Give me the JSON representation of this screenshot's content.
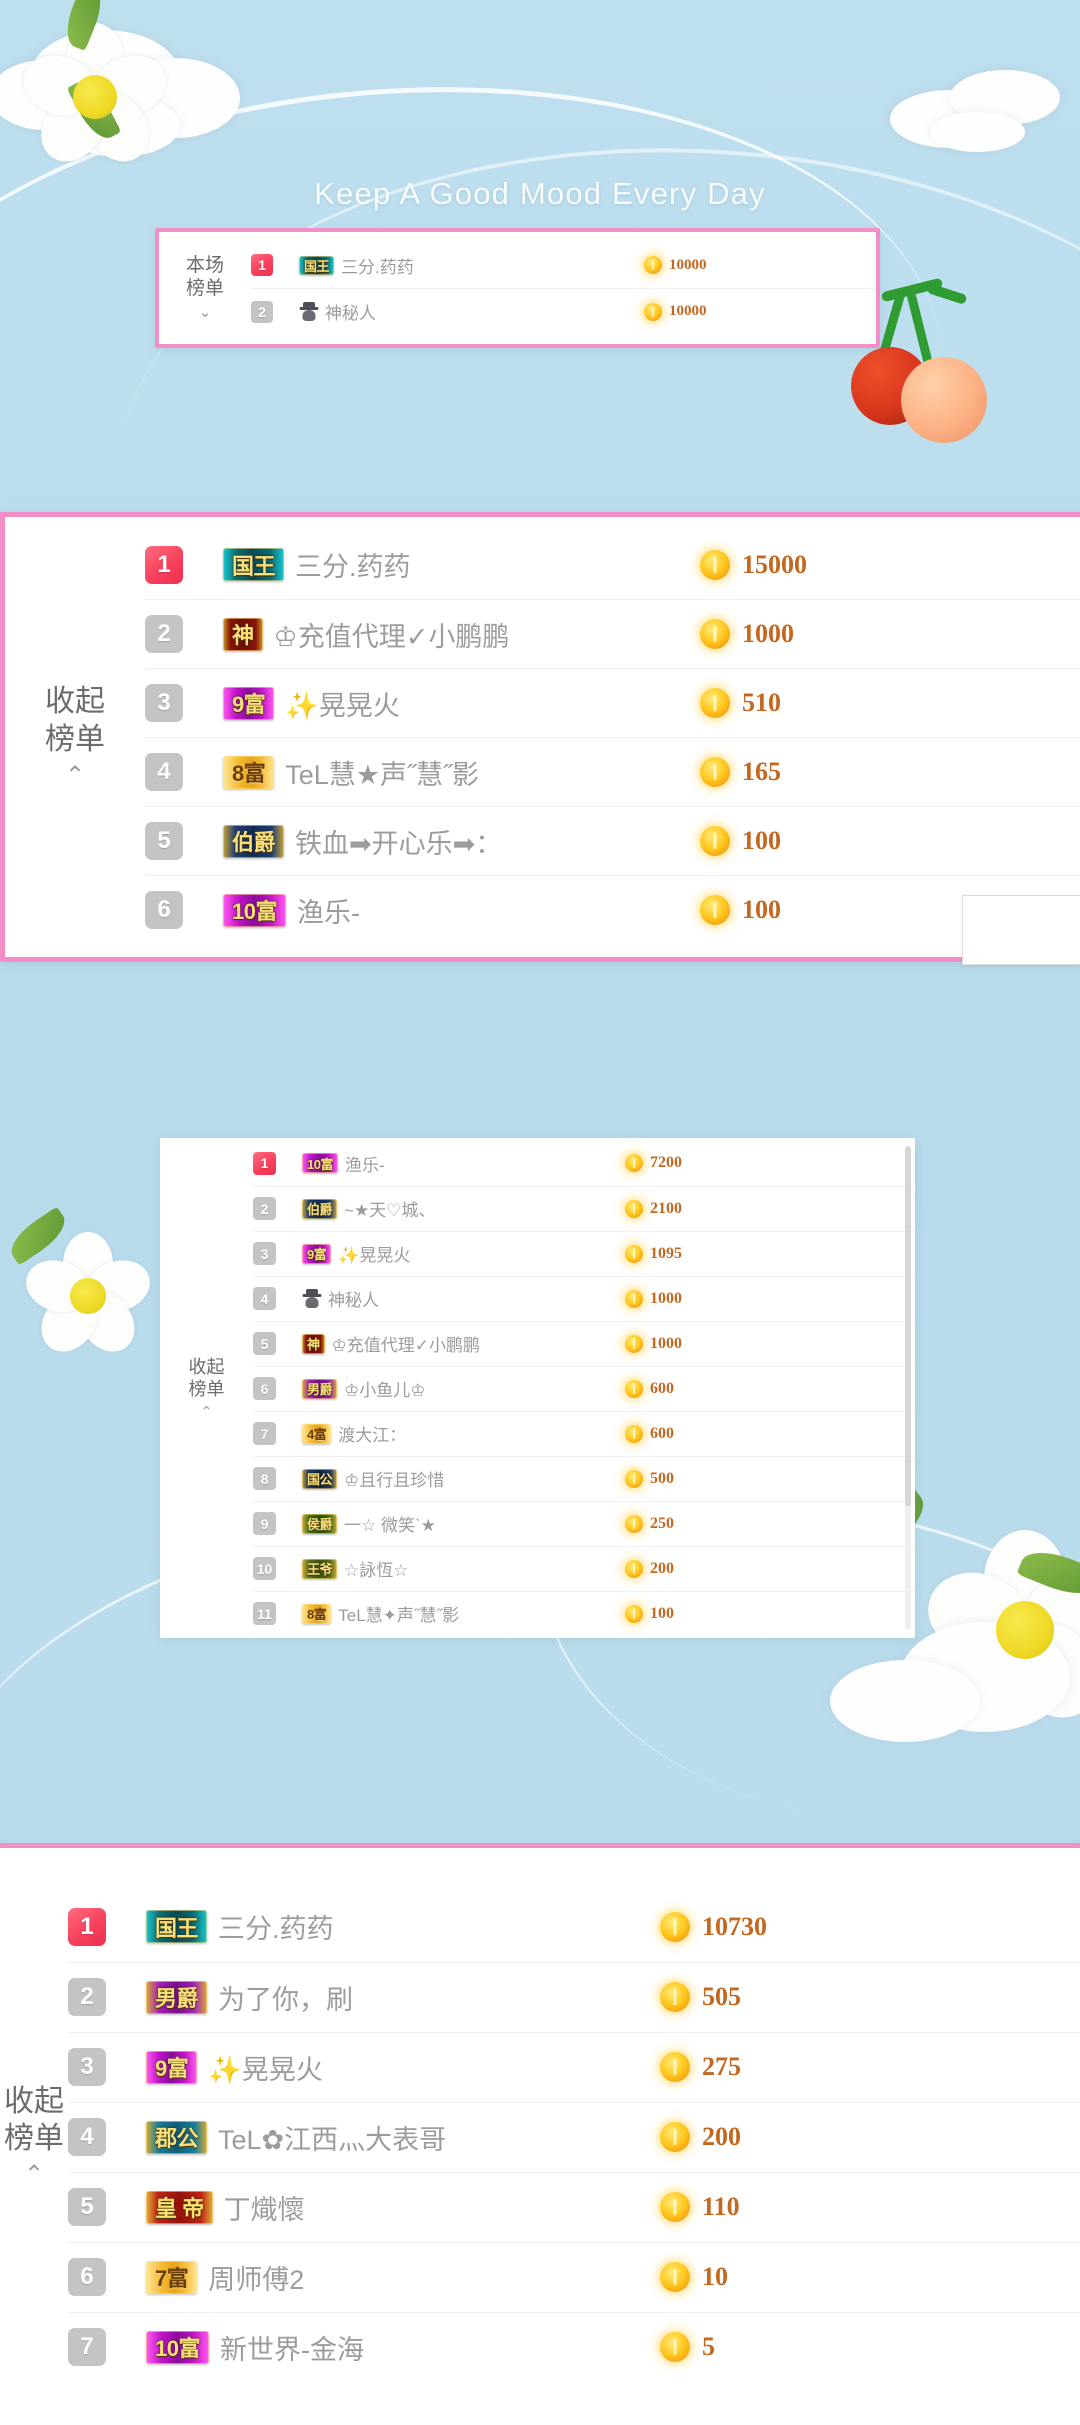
{
  "banner": {
    "title": "Keep A Good Mood Every Day"
  },
  "theme": {
    "background": "#b9dced",
    "panel_border_pink": "#f48ec6",
    "rank1_badge": "#f8415c",
    "rank_badge": "#c4c4c4",
    "amount_color": "#c4671f",
    "coin_color": "#ffc81e",
    "username_color": "#9c9c9c"
  },
  "panels": [
    {
      "id": "panel1",
      "collapse_label_line1": "本场",
      "collapse_label_line2": "榜单",
      "chevron": "⌄",
      "chevron_name": "chevron-down-icon",
      "rows": [
        {
          "rank": "1",
          "badge": "国王",
          "badge_style": "king",
          "name": "三分.药药",
          "amount": "10000",
          "icon": ""
        },
        {
          "rank": "2",
          "badge": "",
          "badge_style": "",
          "name": "神秘人",
          "amount": "10000",
          "icon": "mystery-person-icon"
        }
      ]
    },
    {
      "id": "panel2",
      "collapse_label_line1": "收起",
      "collapse_label_line2": "榜单",
      "chevron": "⌃",
      "chevron_name": "chevron-up-icon",
      "rows": [
        {
          "rank": "1",
          "badge": "国王",
          "badge_style": "king",
          "name": "三分.药药",
          "amount": "15000",
          "icon": ""
        },
        {
          "rank": "2",
          "badge": "神",
          "badge_style": "god",
          "name": "♔充值代理✓小鹏鹏",
          "amount": "1000",
          "icon": ""
        },
        {
          "rank": "3",
          "badge": "9富",
          "badge_style": "purple",
          "name": "✨晃晃火",
          "amount": "510",
          "icon": ""
        },
        {
          "rank": "4",
          "badge": "8富",
          "badge_style": "gold",
          "name": "TeL慧★声˝慧˝影",
          "amount": "165",
          "icon": ""
        },
        {
          "rank": "5",
          "badge": "伯爵",
          "badge_style": "earl",
          "name": "铁血➡开心乐➡：",
          "amount": "100",
          "icon": ""
        },
        {
          "rank": "6",
          "badge": "10富",
          "badge_style": "purple",
          "name": "渔乐-",
          "amount": "100",
          "icon": ""
        }
      ]
    },
    {
      "id": "panel3",
      "collapse_label_line1": "收起",
      "collapse_label_line2": "榜单",
      "chevron": "⌃",
      "chevron_name": "chevron-up-icon",
      "rows": [
        {
          "rank": "1",
          "badge": "10富",
          "badge_style": "purple",
          "name": "渔乐-",
          "amount": "7200",
          "icon": ""
        },
        {
          "rank": "2",
          "badge": "伯爵",
          "badge_style": "earl",
          "name": "~★天♡城、",
          "amount": "2100",
          "icon": ""
        },
        {
          "rank": "3",
          "badge": "9富",
          "badge_style": "purple",
          "name": "✨晃晃火",
          "amount": "1095",
          "icon": ""
        },
        {
          "rank": "4",
          "badge": "",
          "badge_style": "",
          "name": "神秘人",
          "amount": "1000",
          "icon": "mystery-person-icon"
        },
        {
          "rank": "5",
          "badge": "神",
          "badge_style": "god",
          "name": "♔充值代理✓小鹏鹏",
          "amount": "1000",
          "icon": ""
        },
        {
          "rank": "6",
          "badge": "男爵",
          "badge_style": "baron",
          "name": "♔小鱼儿♔",
          "amount": "600",
          "icon": ""
        },
        {
          "rank": "7",
          "badge": "4富",
          "badge_style": "gold",
          "name": "渡大江：",
          "amount": "600",
          "icon": ""
        },
        {
          "rank": "8",
          "badge": "国公",
          "badge_style": "duke",
          "name": "♔且行且珍惜",
          "amount": "500",
          "icon": ""
        },
        {
          "rank": "9",
          "badge": "侯爵",
          "badge_style": "marq",
          "name": "一☆ 微笑ˋ★",
          "amount": "250",
          "icon": ""
        },
        {
          "rank": "10",
          "badge": "王爷",
          "badge_style": "prince",
          "name": "☆詠恆☆",
          "amount": "200",
          "icon": ""
        },
        {
          "rank": "11",
          "badge": "8富",
          "badge_style": "gold",
          "name": "TeL慧✦声˝慧˝影",
          "amount": "100",
          "icon": ""
        }
      ]
    },
    {
      "id": "panel4",
      "collapse_label_line1": "收起",
      "collapse_label_line2": "榜单",
      "chevron": "⌃",
      "chevron_name": "chevron-up-icon",
      "rows": [
        {
          "rank": "1",
          "badge": "国王",
          "badge_style": "king",
          "name": "三分.药药",
          "amount": "10730",
          "icon": ""
        },
        {
          "rank": "2",
          "badge": "男爵",
          "badge_style": "baron",
          "name": "为了你，刷",
          "amount": "505",
          "icon": ""
        },
        {
          "rank": "3",
          "badge": "9富",
          "badge_style": "purple",
          "name": "✨晃晃火",
          "amount": "275",
          "icon": ""
        },
        {
          "rank": "4",
          "badge": "郡公",
          "badge_style": "county",
          "name": "TeL✿江西灬大表哥",
          "amount": "200",
          "icon": ""
        },
        {
          "rank": "5",
          "badge": "皇 帝",
          "badge_style": "emperor",
          "name": "丁熾懷",
          "amount": "110",
          "icon": ""
        },
        {
          "rank": "6",
          "badge": "7富",
          "badge_style": "gold",
          "name": "周师傅2",
          "amount": "10",
          "icon": ""
        },
        {
          "rank": "7",
          "badge": "10富",
          "badge_style": "purple",
          "name": "新世界-金海",
          "amount": "5",
          "icon": ""
        }
      ]
    }
  ]
}
